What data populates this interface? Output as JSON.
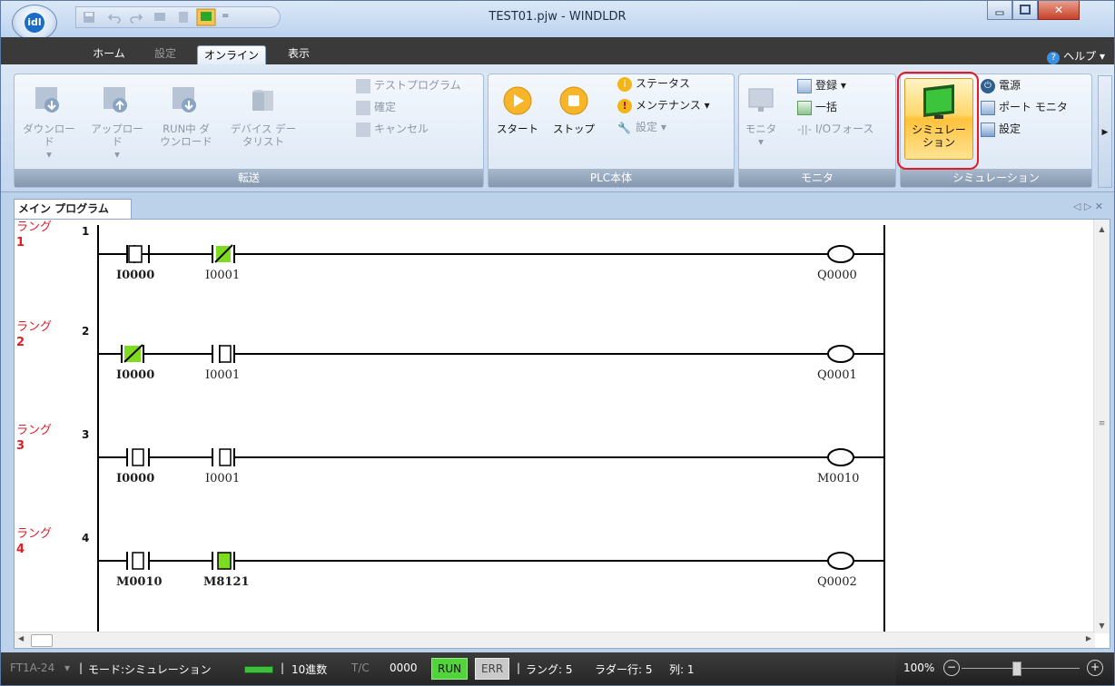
{
  "window": {
    "title": "TEST01.pjw - WINDLDR"
  },
  "ribbon_tabs": [
    "ホーム",
    "設定",
    "オンライン",
    "表示"
  ],
  "help_label": "ヘルプ",
  "groups": {
    "transfer": {
      "caption": "転送",
      "download": "ダウンロード",
      "upload": "アップロード",
      "run_download_1": "RUN中 ダ",
      "run_download_2": "ウンロード",
      "device_1": "デバイス デー",
      "device_2": "タリスト",
      "test_program": "テストプログラム",
      "confirm": "確定",
      "cancel": "キャンセル"
    },
    "plc": {
      "caption": "PLC本体",
      "start": "スタート",
      "stop": "ストップ",
      "status": "ステータス",
      "maintenance": "メンテナンス",
      "settings": "設定"
    },
    "monitor": {
      "caption": "モニタ",
      "monitor": "モニタ",
      "register": "登録",
      "batch": "一括",
      "io_force": "I/Oフォース"
    },
    "simulation": {
      "caption": "シミュレーション",
      "sim_1": "シミュレー",
      "sim_2": "ション",
      "power": "電源",
      "port_monitor": "ポート モニタ",
      "settings": "設定"
    }
  },
  "document": {
    "tab": "メイン プログラム",
    "rung_word": "ラング",
    "rungs": [
      {
        "num": "1",
        "idx": "1",
        "c1": "I0000",
        "c2": "I0001",
        "coil": "Q0000"
      },
      {
        "num": "2",
        "idx": "2",
        "c1": "I0000",
        "c2": "I0001",
        "coil": "Q0001"
      },
      {
        "num": "3",
        "idx": "3",
        "c1": "I0000",
        "c2": "I0001",
        "coil": "M0010"
      },
      {
        "num": "4",
        "idx": "4",
        "c1": "M0010",
        "c2": "M8121",
        "coil": "Q0002"
      }
    ]
  },
  "statusbar": {
    "model": "FT1A-24",
    "mode": "モード:シミュレーション",
    "radix": "10進数",
    "tc": "T/C",
    "tc_value": "0000",
    "run": "RUN",
    "err": "ERR",
    "rung_info": "ラング: 5",
    "ladder_rows": "ラダー行: 5",
    "column": "列: 1",
    "zoom": "100%"
  },
  "colors": {
    "accent": "#e21b25",
    "on_contact": "#7ddc1f",
    "run": "#53d33c"
  }
}
